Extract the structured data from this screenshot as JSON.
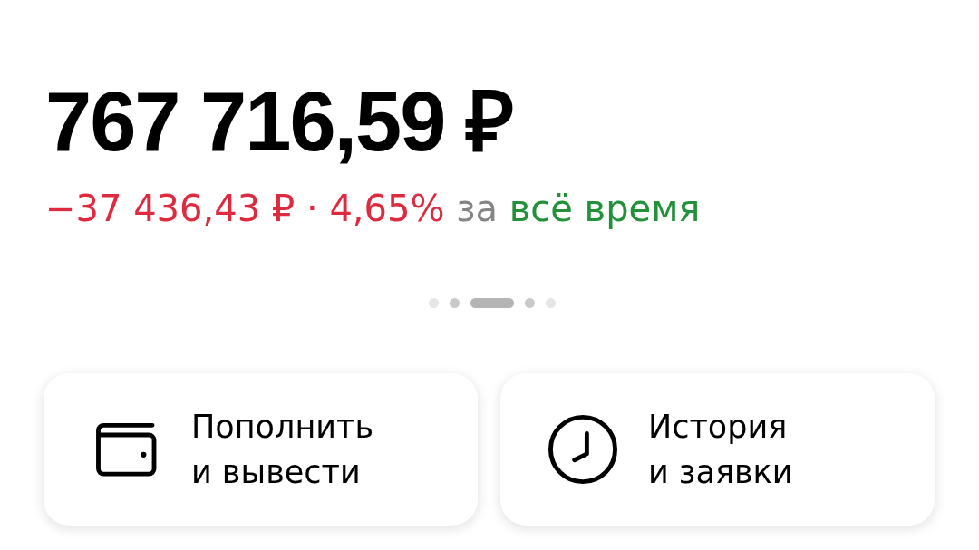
{
  "balance": {
    "amount": "767 716,59 ₽"
  },
  "change": {
    "value": "−37 436,43 ₽ · 4,65%",
    "negative": true
  },
  "period": {
    "prefix": "за",
    "label": "всё время"
  },
  "pager": {
    "pages": [
      {
        "selected": false
      },
      {
        "selected": false
      },
      {
        "selected": true
      },
      {
        "selected": false
      },
      {
        "selected": false
      }
    ]
  },
  "actions": [
    {
      "kind": "wallet",
      "label": "Пополнить\nи вывести"
    },
    {
      "kind": "clock",
      "label": "История\nи заявки"
    }
  ]
}
